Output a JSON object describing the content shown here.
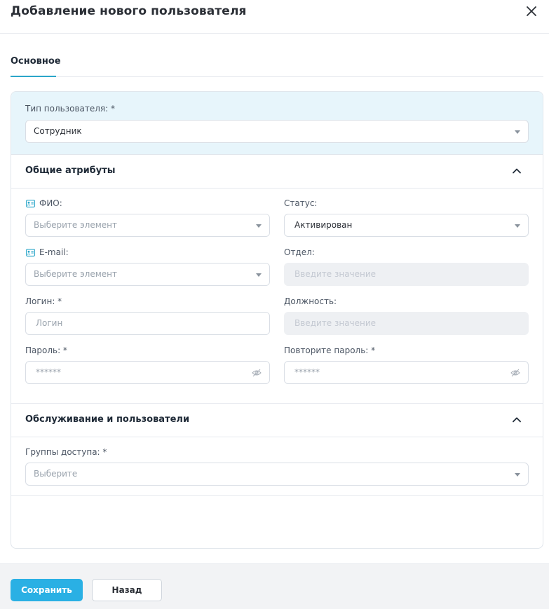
{
  "dialog": {
    "title": "Добавление нового пользователя"
  },
  "tabs": [
    {
      "label": "Основное",
      "active": true
    }
  ],
  "user_type": {
    "label": "Тип пользователя: *",
    "value": "Сотрудник"
  },
  "general": {
    "title": "Общие атрибуты",
    "fio": {
      "label": "ФИО:",
      "placeholder": "Выберите элемент"
    },
    "status": {
      "label": "Статус:",
      "value": "Активирован"
    },
    "email": {
      "label": "E-mail:",
      "placeholder": "Выберите элемент"
    },
    "department": {
      "label": "Отдел:",
      "placeholder": "Введите значение"
    },
    "login": {
      "label": "Логин: *",
      "placeholder": "Логин"
    },
    "position": {
      "label": "Должность:",
      "placeholder": "Введите значение"
    },
    "password": {
      "label": "Пароль: *",
      "placeholder": "******"
    },
    "password_repeat": {
      "label": "Повторите пароль: *",
      "placeholder": "******"
    }
  },
  "service": {
    "title": "Обслуживание и пользователи",
    "groups": {
      "label": "Группы доступа: *",
      "placeholder": "Выберите"
    }
  },
  "footer": {
    "save_label": "Сохранить",
    "back_label": "Назад"
  },
  "colors": {
    "accent": "#2ab0e4",
    "tab_underline": "#2ba6c9",
    "type_block_bg": "#e7f5fb"
  }
}
